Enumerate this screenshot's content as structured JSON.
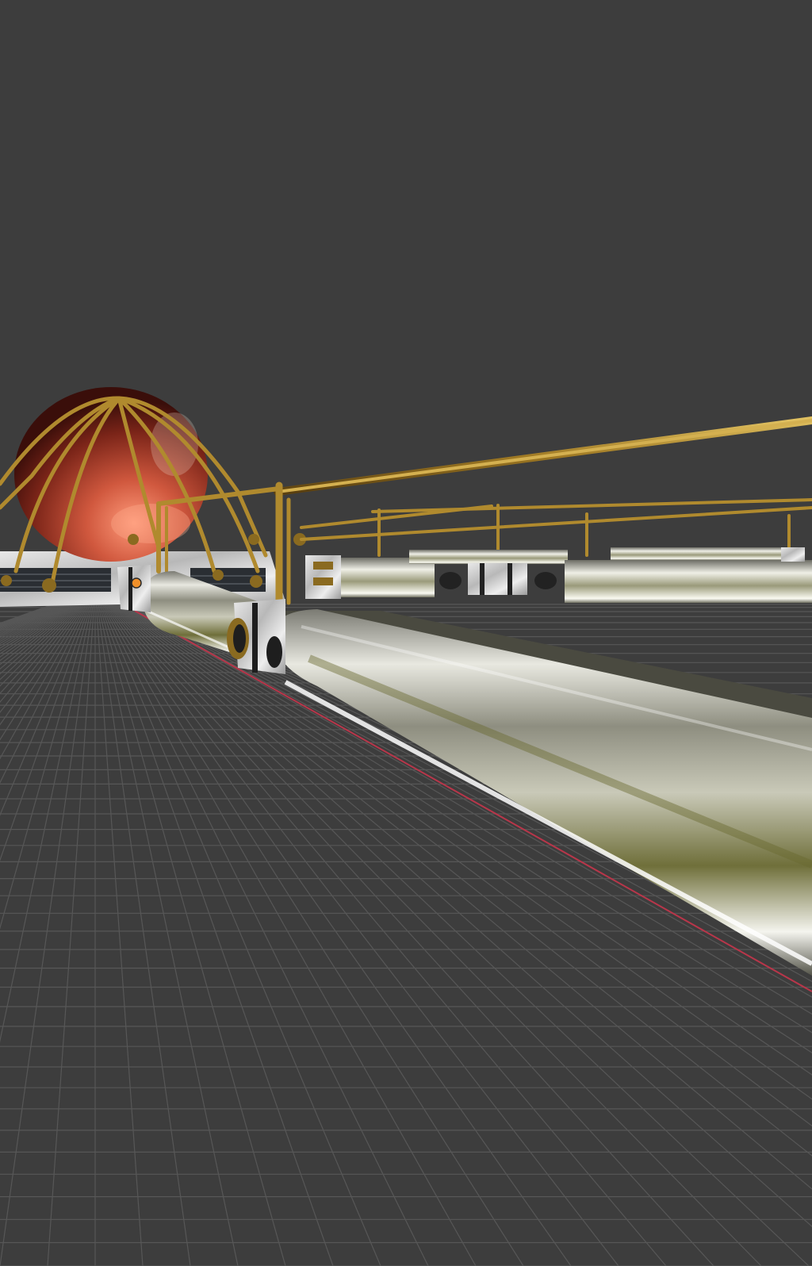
{
  "viewport": {
    "kind": "3d-viewport",
    "view": "perspective",
    "grid_floor": true,
    "x_axis_line": true
  },
  "colors": {
    "background": "#3d3d3d",
    "grid_line": "#5a5a5a",
    "x_axis": "#c0394a",
    "brass": "#b08a2e",
    "copper": "#c0523a",
    "chrome": "#d8d8d0",
    "marble": "#d9d9d9",
    "origin_dot": "#f0902a"
  },
  "scene_objects": [
    {
      "name": "copper-sphere",
      "material": "copper"
    },
    {
      "name": "brass-cage-wires",
      "material": "brass"
    },
    {
      "name": "marble-base",
      "material": "marble"
    },
    {
      "name": "brass-railings",
      "material": "brass"
    },
    {
      "name": "chrome-pipes",
      "material": "chrome"
    },
    {
      "name": "marble-clamps",
      "material": "marble"
    }
  ]
}
